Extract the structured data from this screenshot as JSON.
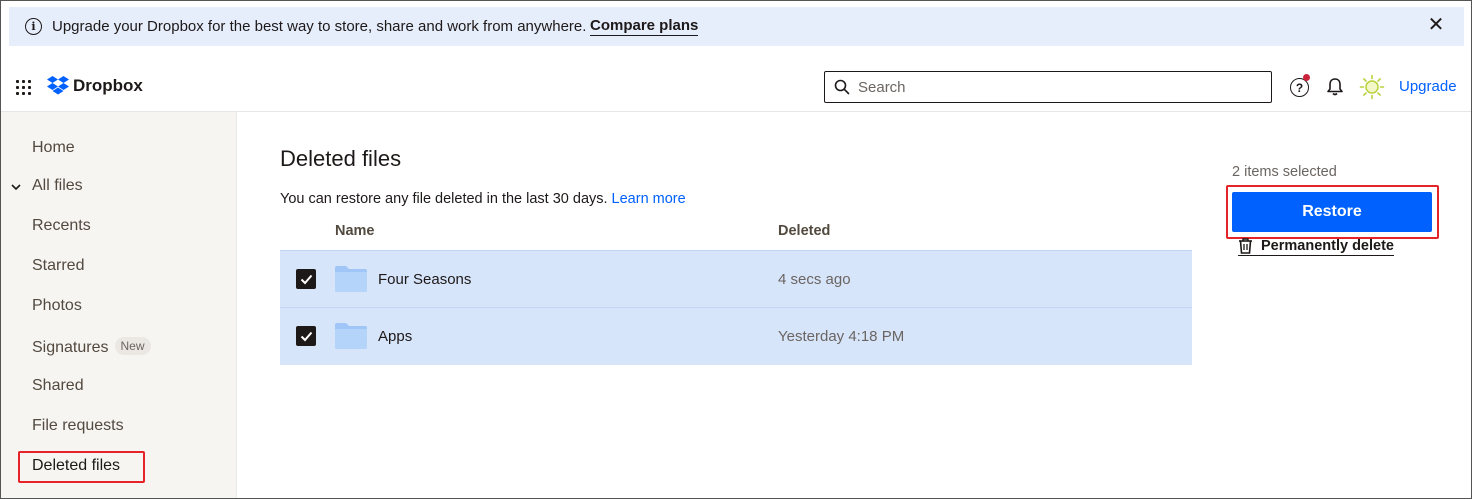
{
  "banner": {
    "text": "Upgrade your Dropbox for the best way to store, share and work from anywhere.",
    "compare_label": "Compare plans"
  },
  "header": {
    "logo_text": "Dropbox",
    "search_placeholder": "Search",
    "help_symbol": "?",
    "upgrade_label": "Upgrade"
  },
  "sidebar": {
    "items": [
      {
        "label": "Home"
      },
      {
        "label": "All files"
      },
      {
        "label": "Recents"
      },
      {
        "label": "Starred"
      },
      {
        "label": "Photos"
      },
      {
        "label": "Signatures",
        "badge": "New"
      },
      {
        "label": "Shared"
      },
      {
        "label": "File requests"
      },
      {
        "label": "Deleted files"
      }
    ]
  },
  "main": {
    "title": "Deleted files",
    "subtitle": "You can restore any file deleted in the last 30 days.",
    "learn_more": "Learn more",
    "columns": {
      "name": "Name",
      "deleted": "Deleted"
    },
    "rows": [
      {
        "name": "Four Seasons",
        "deleted": "4 secs ago",
        "checked": true
      },
      {
        "name": "Apps",
        "deleted": "Yesterday 4:18 PM",
        "checked": true
      }
    ]
  },
  "panel": {
    "selected_count": "2 items selected",
    "restore_label": "Restore",
    "permanent_delete_label": "Permanently delete"
  },
  "colors": {
    "accent": "#0061fe",
    "selected_row": "#d7e5fb",
    "sidebar_bg": "#f7f5f2",
    "banner_bg": "#e6eefc",
    "highlight_annotation": "#e5242a"
  },
  "icons": [
    "info-icon",
    "close-icon",
    "apps-grid-icon",
    "dropbox-logo-icon",
    "search-icon",
    "help-icon",
    "bell-icon",
    "avatar-sun-icon",
    "chevron-down-icon",
    "folder-icon",
    "checkmark-icon",
    "trash-icon"
  ]
}
